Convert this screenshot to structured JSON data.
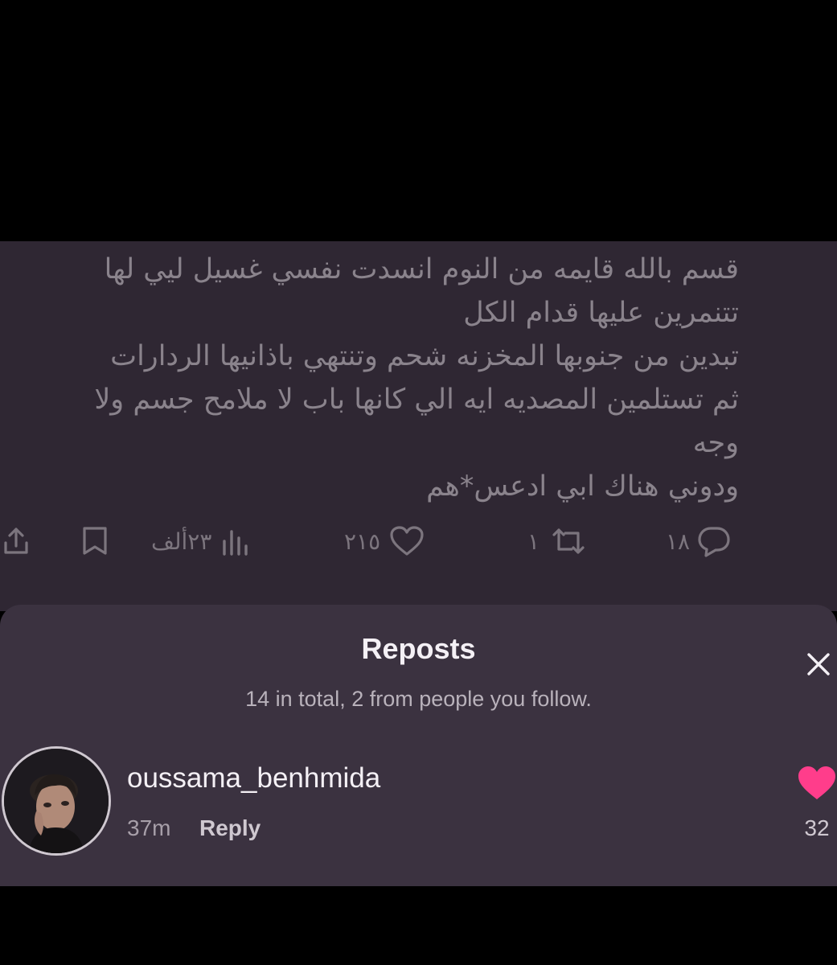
{
  "tweet": {
    "lines": [
      "قسم بالله قايمه من النوم انسدت نفسي غسيل ليي لها",
      "تتنمرين عليها قدام الكل",
      " تبدين من جنوبها المخزنه شحم وتنتهي باذانيها الردارات",
      "ثم تستلمين المصديه ايه الي كانها باب لا ملامح جسم ولا",
      "وجه",
      "ودوني هناك ابي ادعس*هم"
    ],
    "actions": {
      "replies": "١٨",
      "reposts": "١",
      "likes": "٢١٥",
      "views": "٢٣ألف",
      "icons": [
        "reply-icon",
        "repost-icon",
        "like-icon",
        "views-icon",
        "bookmark-icon",
        "share-icon"
      ]
    }
  },
  "sheet": {
    "title": "Reposts",
    "subtitle": "14 in total, 2 from people you follow.",
    "close_icon": "close-icon"
  },
  "repost_item": {
    "username": "oussama_benhmida",
    "time": "37m",
    "reply_label": "Reply",
    "like_count": "32",
    "heart_color": "#ff3d8b"
  },
  "colors": {
    "tweet_background": "#2f2733",
    "sheet_background": "#3b3240",
    "muted_text": "#8a838c"
  }
}
